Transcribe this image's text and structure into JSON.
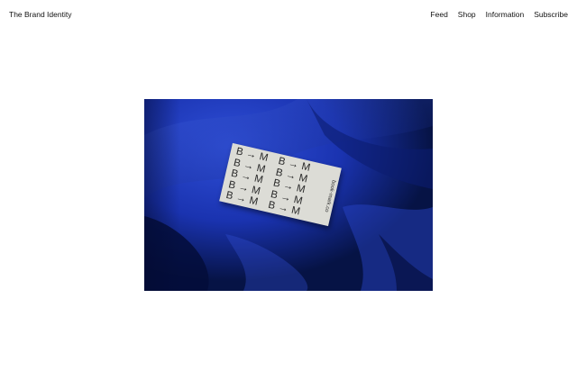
{
  "header": {
    "brand": "The Brand Identity",
    "nav": [
      {
        "label": "Feed"
      },
      {
        "label": "Shop"
      },
      {
        "label": "Information"
      },
      {
        "label": "Subscribe"
      }
    ]
  },
  "hero": {
    "card": {
      "rows": [
        [
          "B → M",
          "B → M"
        ],
        [
          "B → M",
          "B → M"
        ],
        [
          "B → M",
          "B → M"
        ],
        [
          "B → M",
          "B → M"
        ],
        [
          "B → M",
          "B → M"
        ]
      ],
      "url": "book-mark.co"
    }
  }
}
